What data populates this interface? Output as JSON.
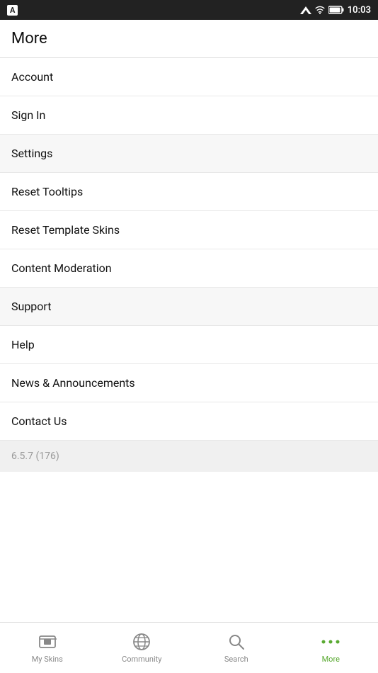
{
  "statusBar": {
    "time": "10:03",
    "appIcon": "A"
  },
  "pageTitle": "More",
  "menuItems": [
    {
      "id": "account",
      "label": "Account",
      "shaded": false
    },
    {
      "id": "sign-in",
      "label": "Sign In",
      "shaded": false
    },
    {
      "id": "settings",
      "label": "Settings",
      "shaded": true
    },
    {
      "id": "reset-tooltips",
      "label": "Reset Tooltips",
      "shaded": false
    },
    {
      "id": "reset-template-skins",
      "label": "Reset Template Skins",
      "shaded": false
    },
    {
      "id": "content-moderation",
      "label": "Content Moderation",
      "shaded": false
    },
    {
      "id": "support",
      "label": "Support",
      "shaded": true
    },
    {
      "id": "help",
      "label": "Help",
      "shaded": false
    },
    {
      "id": "news-announcements",
      "label": "News & Announcements",
      "shaded": false
    },
    {
      "id": "contact-us",
      "label": "Contact Us",
      "shaded": false
    }
  ],
  "versionText": "6.5.7 (176)",
  "bottomNav": {
    "items": [
      {
        "id": "my-skins",
        "label": "My Skins",
        "active": false
      },
      {
        "id": "community",
        "label": "Community",
        "active": false
      },
      {
        "id": "search",
        "label": "Search",
        "active": false
      },
      {
        "id": "more",
        "label": "More",
        "active": true
      }
    ]
  },
  "colors": {
    "activeGreen": "#5aaa32",
    "inactiveGray": "#888888"
  }
}
